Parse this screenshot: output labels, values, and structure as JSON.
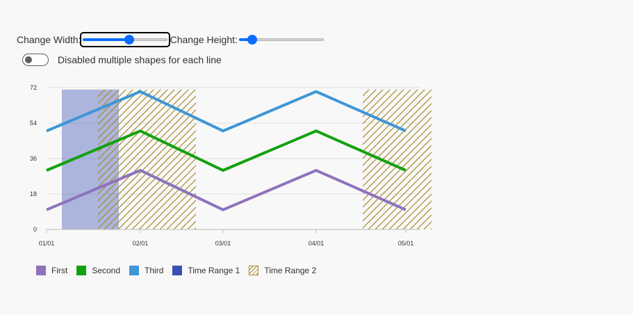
{
  "controls": {
    "width_label": "Change Width:",
    "width_value": 0.55,
    "height_label": "Change Height:",
    "height_value": 0.16,
    "toggle_label": "Disabled multiple shapes for each line",
    "toggle_on": false,
    "accent_color": "#0a6cff"
  },
  "chart_data": {
    "type": "line",
    "categories": [
      "01/01",
      "02/01",
      "03/01",
      "04/01",
      "05/01"
    ],
    "ylim": [
      0,
      72
    ],
    "yticks": [
      0,
      18,
      36,
      54,
      72
    ],
    "series": [
      {
        "name": "First",
        "color": "#8e72bd",
        "values": [
          10,
          30,
          10,
          30,
          10
        ]
      },
      {
        "name": "Second",
        "color": "#13a10e",
        "values": [
          30,
          50,
          30,
          50,
          30
        ]
      },
      {
        "name": "Third",
        "color": "#3d96d6",
        "values": [
          50,
          70,
          50,
          70,
          50
        ]
      }
    ],
    "time_ranges": [
      {
        "name": "Time Range 1",
        "color": "#3a4fb5",
        "style": "solid",
        "start": "01/01 +0.16",
        "end": "01/01 +0.78",
        "ymax": 71
      },
      {
        "name": "Time Range 2",
        "color": "#a88a2a",
        "style": "hatched",
        "segments": [
          {
            "start": "01/01 +0.55",
            "end": "02/01 +0.60",
            "ymax": 71
          },
          {
            "start": "04/01 +0.50",
            "end": "05/01 +0.30",
            "ymax": 71
          }
        ]
      }
    ],
    "grid": true,
    "legend_position": "bottom-left"
  }
}
